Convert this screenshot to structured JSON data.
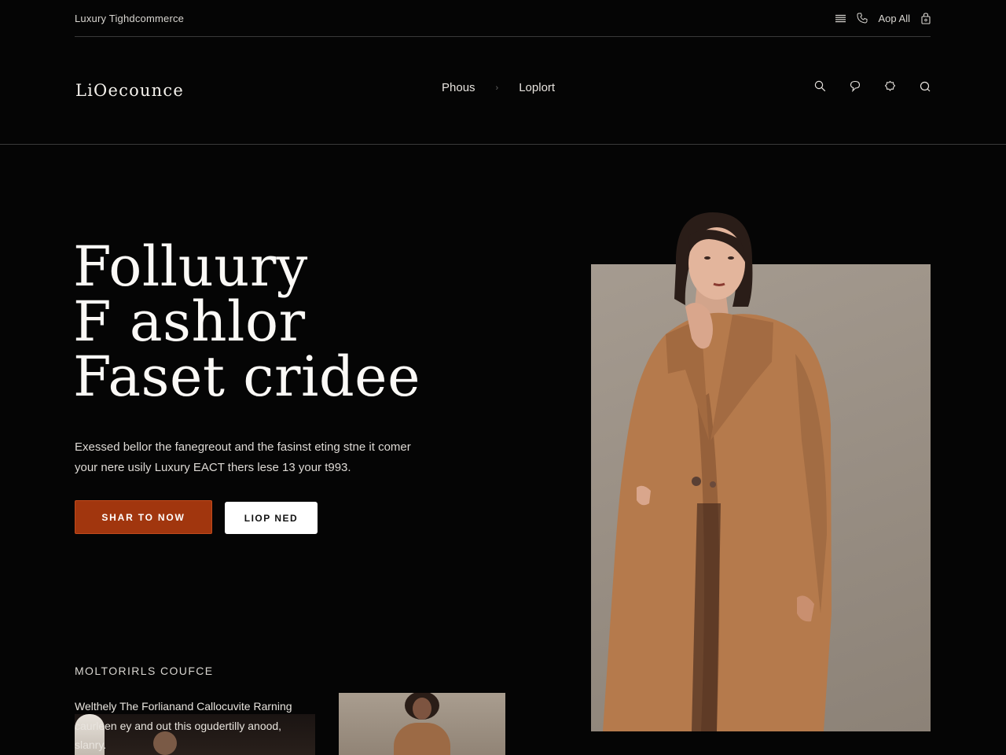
{
  "topbar": {
    "brand_line": "Luxury Tighdcommerce",
    "app_label": "Aop All",
    "icons": [
      "menu-icon",
      "phone-icon",
      "bag-icon"
    ]
  },
  "header": {
    "logo": "LiOecounce",
    "nav": [
      "Phous",
      "Loplort"
    ],
    "actions": [
      "search-icon",
      "chat-icon",
      "settings-icon",
      "search-icon"
    ]
  },
  "hero": {
    "title_lines": [
      "Folluury",
      "F ashlor",
      "Faset cridee"
    ],
    "description_lines": [
      "Exessed bellor the fanegreout and the fasinst eting stne it comer",
      "your nere usily Luxury EACT thers lese 13 your t993."
    ],
    "primary_button": "SHAR TO NOW",
    "secondary_button": "LIOP NED"
  },
  "collection": {
    "title": "MOLTORIRLS COUFCE",
    "text_lines": [
      "Welthely The Forlianand Callocuvite Rarning",
      "caurleen ey and out this ogudertilly anood,",
      "slanry."
    ]
  },
  "colors": {
    "background": "#050505",
    "accent": "#a1360e",
    "coat": "#b57a4c",
    "image_backdrop": "#9e948a"
  }
}
